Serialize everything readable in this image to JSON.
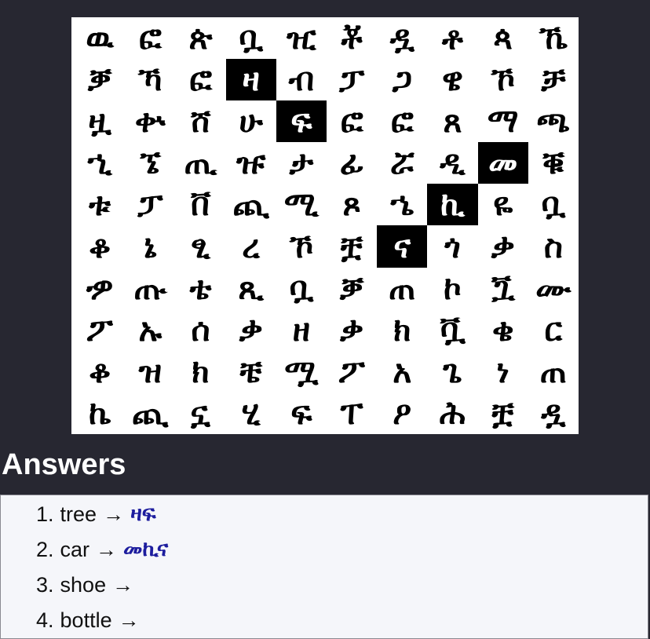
{
  "grid": {
    "rows": [
      [
        "ዉ",
        "ፎ",
        "ጵ",
        "ቧ",
        "ዢ",
        "ቾ",
        "ዷ",
        "ቶ",
        "ጳ",
        "ኼ"
      ],
      [
        "ቓ",
        "ኻ",
        "ፎ",
        "ዛ",
        "ብ",
        "ፓ",
        "ጋ",
        "ዌ",
        "ኾ",
        "ቻ"
      ],
      [
        "ዟ",
        "ቍ",
        "ሸ",
        "ሁ",
        "ፍ",
        "ፎ",
        "ፎ",
        "ጸ",
        "ማ",
        "ጫ"
      ],
      [
        "ኂ",
        "ኜ",
        "ጢ",
        "ዡ",
        "ታ",
        "ፊ",
        "ሯ",
        "ዲ",
        "መ",
        "ቑ"
      ],
      [
        "ቱ",
        "ፓ",
        "ቨ",
        "ጪ",
        "ሚ",
        "ጾ",
        "ኄ",
        "ኪ",
        "ዬ",
        "ቧ"
      ],
      [
        "ቆ",
        "ኔ",
        "ፂ",
        "ረ",
        "ኾ",
        "ቿ",
        "ና",
        "ጎ",
        "ቃ",
        "ስ"
      ],
      [
        "ዏ",
        "ጡ",
        "ቴ",
        "ጺ",
        "ቧ",
        "ቓ",
        "ጠ",
        "ኮ",
        "ጟ",
        "ሙ"
      ],
      [
        "ፖ",
        "ኡ",
        "ሰ",
        "ቃ",
        "ዘ",
        "ቃ",
        "ክ",
        "ቯ",
        "ቄ",
        "ር"
      ],
      [
        "ቆ",
        "ዝ",
        "ክ",
        "ቼ",
        "ሟ",
        "ፖ",
        "አ",
        "ጌ",
        "ነ",
        "ጠ"
      ],
      [
        "ኬ",
        "ጪ",
        "ኗ",
        "ሂ",
        "ፍ",
        "ፐ",
        "ዖ",
        "ሕ",
        "ቿ",
        "ዷ"
      ]
    ],
    "selected": [
      [
        1,
        3
      ],
      [
        2,
        4
      ],
      [
        3,
        8
      ],
      [
        4,
        7
      ],
      [
        5,
        6
      ]
    ]
  },
  "answers": {
    "heading": "Answers",
    "items": [
      {
        "num": "1.",
        "word": "tree",
        "arrow": "→",
        "answer": "ዛፍ"
      },
      {
        "num": "2.",
        "word": "car",
        "arrow": "→",
        "answer": "መኪና"
      },
      {
        "num": "3.",
        "word": "shoe",
        "arrow": "→",
        "answer": ""
      },
      {
        "num": "4.",
        "word": "bottle",
        "arrow": "→",
        "answer": ""
      }
    ]
  },
  "colors": {
    "background": "#272731",
    "grid_bg": "#ffffff",
    "selected_bg": "#000000",
    "answer_text": "#1d1d9e"
  }
}
